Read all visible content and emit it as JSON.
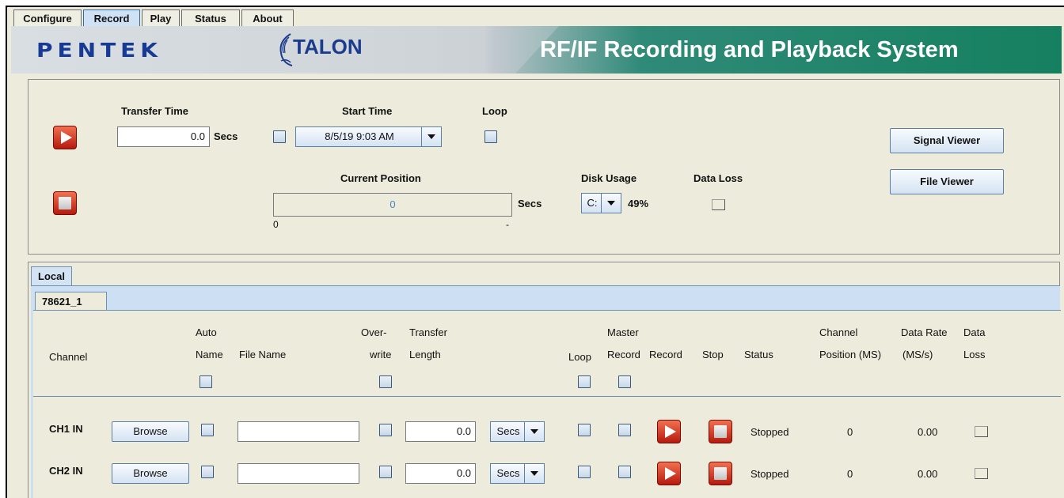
{
  "tabs": [
    "Configure",
    "Record",
    "Play",
    "Status",
    "About"
  ],
  "active_tab": "Record",
  "banner": {
    "brand": "PENTEK",
    "logo": "TALON",
    "title": "RF/IF Recording and Playback System"
  },
  "controls": {
    "transfer_time_label": "Transfer Time",
    "transfer_time_value": "0.0",
    "transfer_time_unit": "Secs",
    "start_time_label": "Start Time",
    "start_time_value": "8/5/19 9:03 AM",
    "loop_label": "Loop",
    "current_position_label": "Current Position",
    "current_position_value": "0",
    "current_position_unit": "Secs",
    "position_min": "0",
    "position_max": "-",
    "disk_usage_label": "Disk Usage",
    "disk_drive": "C:",
    "disk_usage_percent": "49%",
    "data_loss_label": "Data Loss",
    "signal_viewer_label": "Signal Viewer",
    "file_viewer_label": "File Viewer"
  },
  "local_tab": "Local",
  "board_tab": "78621_1",
  "columns": {
    "channel": "Channel",
    "auto_name_1": "Auto",
    "auto_name_2": "Name",
    "file_name": "File Name",
    "overwrite_1": "Over-",
    "overwrite_2": "write",
    "transfer_length_1": "Transfer",
    "transfer_length_2": "Length",
    "loop": "Loop",
    "master_record_1": "Master",
    "master_record_2": "Record",
    "record": "Record",
    "stop": "Stop",
    "status": "Status",
    "channel_position_1": "Channel",
    "channel_position_2": "Position (MS)",
    "data_rate_1": "Data Rate",
    "data_rate_2": "(MS/s)",
    "data_loss_1": "Data",
    "data_loss_2": "Loss"
  },
  "channels": [
    {
      "name": "CH1 IN",
      "browse": "Browse",
      "file_name": "",
      "transfer_length": "0.0",
      "unit": "Secs",
      "status": "Stopped",
      "position": "0",
      "data_rate": "0.00"
    },
    {
      "name": "CH2 IN",
      "browse": "Browse",
      "file_name": "",
      "transfer_length": "0.0",
      "unit": "Secs",
      "status": "Stopped",
      "position": "0",
      "data_rate": "0.00"
    }
  ],
  "colors": {
    "banner_green": "#15805f",
    "brand_blue": "#173a94",
    "button_red": "#c7280f",
    "active_tab": "#cfe1f4"
  }
}
